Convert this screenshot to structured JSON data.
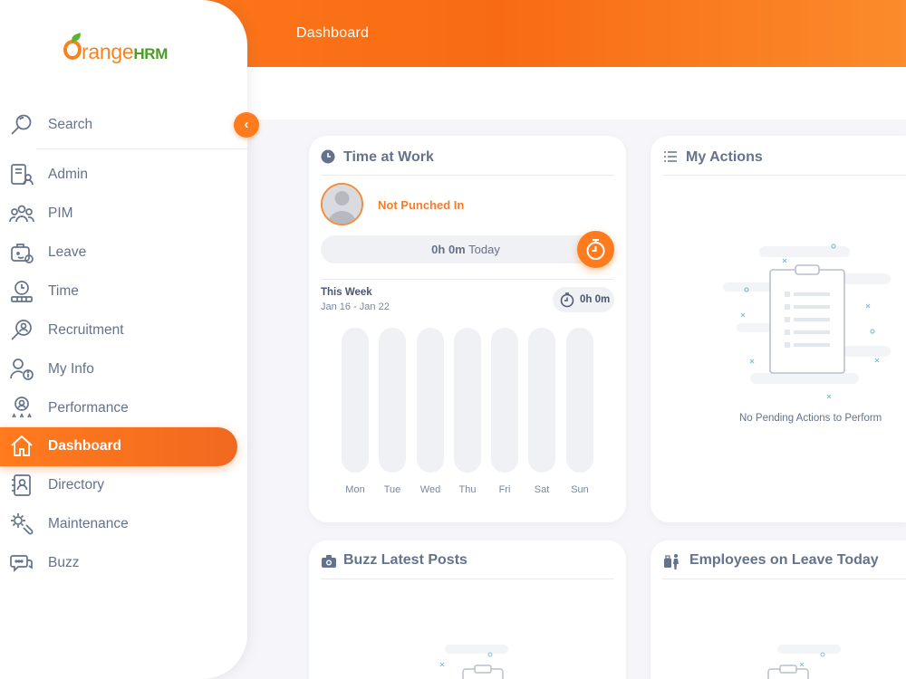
{
  "header": {
    "title": "Dashboard"
  },
  "sidebar": {
    "logo_word": "range",
    "logo_hrm": "HRM",
    "search_label": "Search",
    "collapse_glyph": "‹",
    "items": [
      {
        "label": "Admin",
        "icon": "admin-icon"
      },
      {
        "label": "PIM",
        "icon": "pim-icon"
      },
      {
        "label": "Leave",
        "icon": "leave-icon"
      },
      {
        "label": "Time",
        "icon": "time-icon"
      },
      {
        "label": "Recruitment",
        "icon": "recruitment-icon"
      },
      {
        "label": "My Info",
        "icon": "my-info-icon"
      },
      {
        "label": "Performance",
        "icon": "performance-icon"
      },
      {
        "label": "Dashboard",
        "icon": "home-icon",
        "active": true
      },
      {
        "label": "Directory",
        "icon": "directory-icon"
      },
      {
        "label": "Maintenance",
        "icon": "maintenance-icon"
      },
      {
        "label": "Buzz",
        "icon": "buzz-icon"
      }
    ]
  },
  "time_at_work": {
    "title": "Time at Work",
    "status": "Not Punched In",
    "today_value": "0h 0m",
    "today_label": "Today",
    "week_label": "This Week",
    "week_range": "Jan 16 - Jan 22",
    "week_total": "0h 0m",
    "days": [
      "Mon",
      "Tue",
      "Wed",
      "Thu",
      "Fri",
      "Sat",
      "Sun"
    ]
  },
  "my_actions": {
    "title": "My Actions",
    "empty_message": "No Pending Actions to Perform"
  },
  "buzz": {
    "title": "Buzz Latest Posts"
  },
  "leave_today": {
    "title": "Employees on Leave Today"
  },
  "colors": {
    "accent": "#ff7b1d",
    "text": "#64728c",
    "background": "#f6f6fa"
  }
}
